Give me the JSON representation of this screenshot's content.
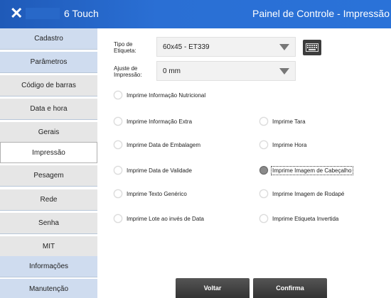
{
  "titlebar": {
    "close_glyph": "✕",
    "app_name": "6 Touch",
    "panel_title": "Painel de Controle - Impressão"
  },
  "sidebar": {
    "items": [
      {
        "label": "Cadastro",
        "style": "blue"
      },
      {
        "label": "Parâmetros",
        "style": "blue"
      },
      {
        "label": "Código de barras",
        "style": "gray"
      },
      {
        "label": "Data e hora",
        "style": "gray"
      },
      {
        "label": "Gerais",
        "style": "gray"
      },
      {
        "label": "Impressão",
        "style": "white",
        "active": true
      },
      {
        "label": "Pesagem",
        "style": "gray"
      },
      {
        "label": "Rede",
        "style": "gray"
      },
      {
        "label": "Senha",
        "style": "gray"
      },
      {
        "label": "MIT",
        "style": "gray"
      },
      {
        "label": "Informações",
        "style": "blue"
      },
      {
        "label": "Manutenção",
        "style": "blue"
      }
    ]
  },
  "form": {
    "label_type": {
      "label": "Tipo de Etiqueta:",
      "value": "60x45 - ET339",
      "keyboard_icon": "keyboard-icon"
    },
    "print_adjust": {
      "label": "Ajuste de Impressão:",
      "value": "0 mm"
    }
  },
  "options": [
    {
      "label": "Imprime Informação Nutricional",
      "checked": false
    },
    {
      "label": "Imprime Informação Extra",
      "checked": false
    },
    {
      "label": "Imprime Tara",
      "checked": false
    },
    {
      "label": "Imprime Data de Embalagem",
      "checked": false
    },
    {
      "label": "Imprime Hora",
      "checked": false
    },
    {
      "label": "Imprime Data de Validade",
      "checked": false
    },
    {
      "label": "Imprime Imagem de Cabeçalho",
      "checked": true,
      "focused": true
    },
    {
      "label": "Imprime Texto Genérico",
      "checked": false
    },
    {
      "label": "Imprime Imagem de Rodapé",
      "checked": false
    },
    {
      "label": "Imprime Lote ao invés de Data",
      "checked": false
    },
    {
      "label": "Imprime Etiqueta Invertida",
      "checked": false
    }
  ],
  "buttons": {
    "back": "Voltar",
    "confirm": "Confirma"
  },
  "colors": {
    "titlebar": "#2a6fd4",
    "sidebar_blue": "#cfdcef",
    "sidebar_gray": "#e6e6e6",
    "button": "#3c3c3c"
  }
}
